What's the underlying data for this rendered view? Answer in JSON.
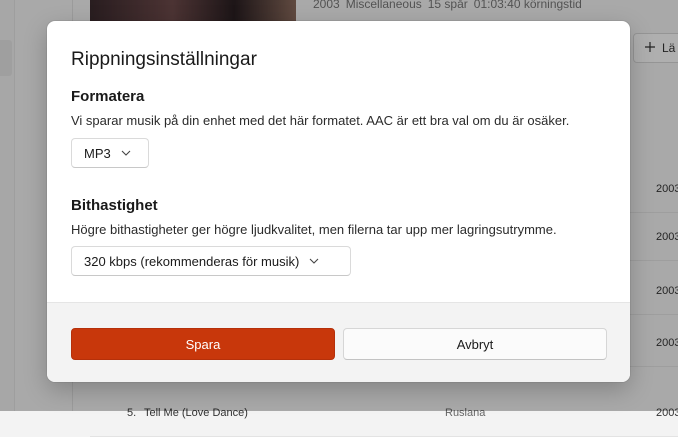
{
  "background": {
    "album_meta": [
      "2003",
      "Miscellaneous",
      "15 spår",
      "01:03:40 körningstid"
    ],
    "add_button_label": "Lä",
    "rows": [
      {
        "year": "2003"
      },
      {
        "year": "2003"
      },
      {
        "year": "2003"
      },
      {
        "year": "2003"
      },
      {
        "year": "2003"
      }
    ],
    "last_row": {
      "number": "5.",
      "title": "Tell Me (Love Dance)",
      "artist": "Ruslana",
      "year": "2003"
    }
  },
  "dialog": {
    "title": "Rippningsinställningar",
    "format": {
      "heading": "Formatera",
      "description": "Vi sparar musik på din enhet med det här formatet. AAC är ett bra val om du är osäker.",
      "selected": "MP3"
    },
    "bitrate": {
      "heading": "Bithastighet",
      "description": "Högre bithastigheter ger högre ljudkvalitet, men filerna tar upp mer lagringsutrymme.",
      "selected": "320 kbps (rekommenderas för musik)"
    },
    "buttons": {
      "save": "Spara",
      "cancel": "Avbryt"
    }
  },
  "colors": {
    "accent": "#c8370b",
    "dialog_bg": "#ffffff",
    "footer_bg": "#f3f3f3"
  },
  "icons": {
    "dropdown": "chevron-down-icon",
    "add": "plus-icon"
  }
}
